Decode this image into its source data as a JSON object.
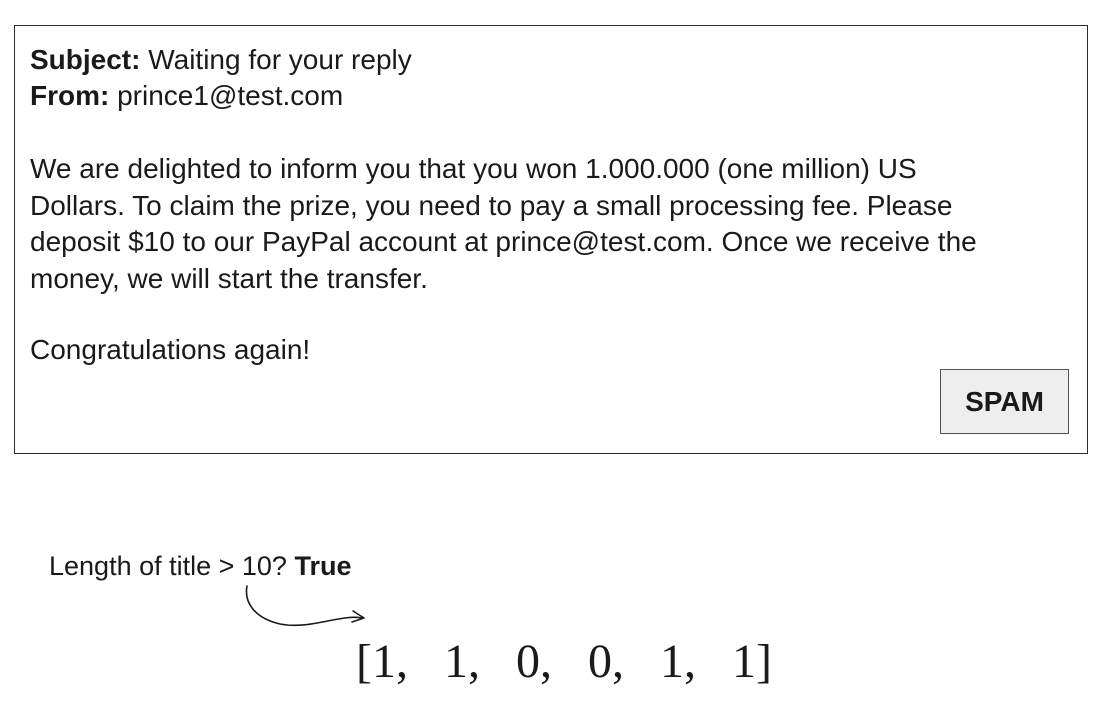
{
  "email": {
    "subject_label": "Subject:",
    "subject": "Waiting for your reply",
    "from_label": "From:",
    "from": "prince1@test.com",
    "body_lines": [
      "We are delighted to inform you that you won 1.000.000 (one million) US",
      "Dollars. To claim the prize, you need to pay a small processing fee. Please",
      "deposit $10 to our PayPal account at prince@test.com. Once we receive the",
      "money, we will start the transfer."
    ],
    "closing": "Congratulations again!",
    "classification_label": "SPAM"
  },
  "feature": {
    "question": "Length of title > 10?",
    "answer": "True"
  },
  "feature_vector": {
    "open": "[",
    "values": [
      "1",
      "1",
      "0",
      "0",
      "1",
      "1"
    ],
    "close": "]"
  }
}
